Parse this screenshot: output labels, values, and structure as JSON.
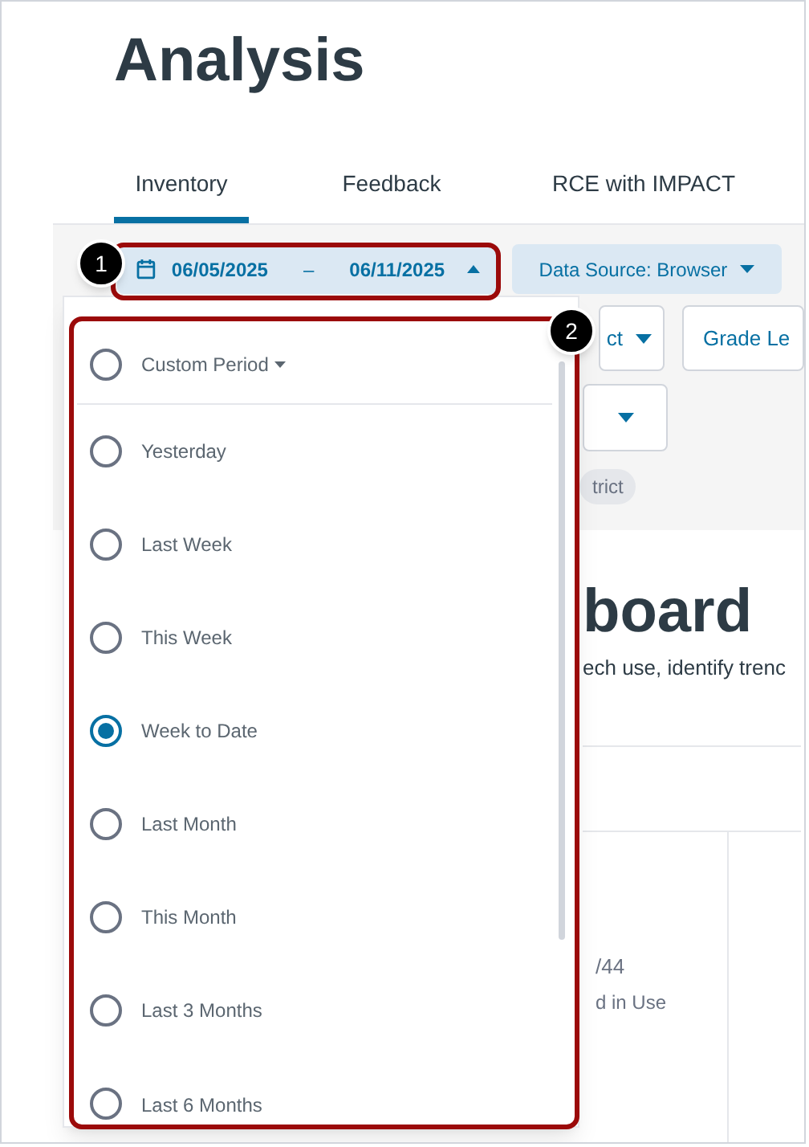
{
  "page_title": "Analysis",
  "tabs": [
    {
      "label": "Inventory",
      "selected": true
    },
    {
      "label": "Feedback",
      "selected": false
    },
    {
      "label": "RCE with IMPACT",
      "selected": false
    }
  ],
  "date_range": {
    "start": "06/05/2025",
    "separator": "–",
    "end": "06/11/2025",
    "expanded": true
  },
  "data_source": {
    "label": "Data Source: Browser"
  },
  "filters": [
    {
      "label": "ct"
    },
    {
      "label": "Grade Le"
    }
  ],
  "chip": "trict",
  "dashboard": {
    "heading": "board",
    "description": "ech use, identify trenc"
  },
  "card": {
    "count": "/44",
    "label": "d in Use"
  },
  "period_options": [
    {
      "label": "Custom Period",
      "kind": "submenu",
      "selected": false
    },
    {
      "label": "Yesterday",
      "kind": "option",
      "selected": false
    },
    {
      "label": "Last Week",
      "kind": "option",
      "selected": false
    },
    {
      "label": "This Week",
      "kind": "option",
      "selected": false
    },
    {
      "label": "Week to Date",
      "kind": "option",
      "selected": true
    },
    {
      "label": "Last Month",
      "kind": "option",
      "selected": false
    },
    {
      "label": "This Month",
      "kind": "option",
      "selected": false
    },
    {
      "label": "Last 3 Months",
      "kind": "option",
      "selected": false
    },
    {
      "label": "Last 6 Months",
      "kind": "option",
      "selected": false
    }
  ],
  "callouts": [
    "1",
    "2"
  ]
}
